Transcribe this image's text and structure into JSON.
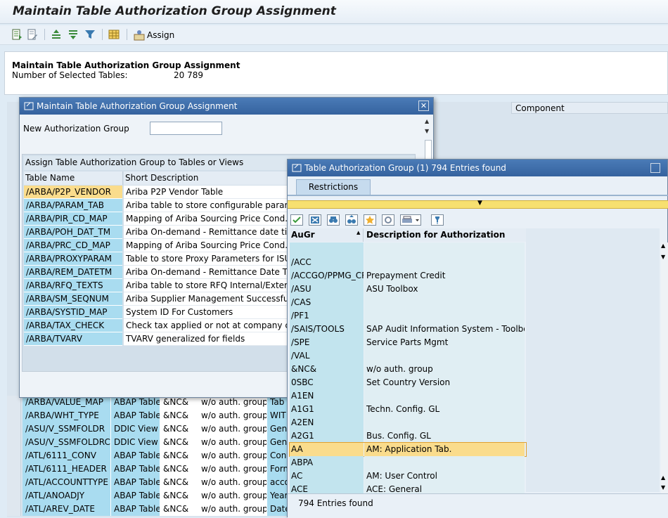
{
  "window": {
    "title": "Maintain Table Authorization Group Assignment"
  },
  "toolbar": {
    "assign_label": "Assign"
  },
  "header": {
    "title": "Maintain Table Authorization Group Assignment",
    "count_label": "Number of Selected Tables:",
    "count_value": "20 789"
  },
  "background_table": {
    "component_header": "Component",
    "rows": [
      {
        "name": "/ARBA/VALUE_MAP",
        "type": "ABAP Table",
        "aug": "&NC&",
        "desc": "w/o auth. group",
        "short": "Tab"
      },
      {
        "name": "/ARBA/WHT_TYPE",
        "type": "ABAP Table",
        "aug": "&NC&",
        "desc": "w/o auth. group",
        "short": "WIT"
      },
      {
        "name": "/ASU/V_SSMFOLDR",
        "type": "DDIC View",
        "aug": "&NC&",
        "desc": "w/o auth. group",
        "short": "Gen"
      },
      {
        "name": "/ASU/V_SSMFOLDRC",
        "type": "DDIC View",
        "aug": "&NC&",
        "desc": "w/o auth. group",
        "short": "Gen"
      },
      {
        "name": "/ATL/6111_CONV",
        "type": "ABAP Table",
        "aug": "&NC&",
        "desc": "w/o auth. group",
        "short": "Conv"
      },
      {
        "name": "/ATL/6111_HEADER",
        "type": "ABAP Table",
        "aug": "&NC&",
        "desc": "w/o auth. group",
        "short": "Form"
      },
      {
        "name": "/ATL/ACCOUNTTYPE",
        "type": "ABAP Table",
        "aug": "&NC&",
        "desc": "w/o auth. group",
        "short": "acco"
      },
      {
        "name": "/ATL/ANOADJY",
        "type": "ABAP Table",
        "aug": "&NC&",
        "desc": "w/o auth. group",
        "short": "Year"
      },
      {
        "name": "/ATL/AREV_DATE",
        "type": "ABAP Table",
        "aug": "&NC&",
        "desc": "w/o auth. group",
        "short": "Date"
      }
    ]
  },
  "dialog1": {
    "title": "Maintain Table Authorization Group Assignment",
    "new_group_label": "New Authorization Group",
    "new_group_value": "",
    "section_label": "Assign Table Authorization Group to Tables or Views",
    "col_name": "Table Name",
    "col_desc": "Short Description",
    "rows": [
      {
        "name": "/ARBA/P2P_VENDOR",
        "desc": "Ariba P2P Vendor Table"
      },
      {
        "name": "/ARBA/PARAM_TAB",
        "desc": "Ariba table to store configurable paramete"
      },
      {
        "name": "/ARBA/PIR_CD_MAP",
        "desc": "Mapping of Ariba Sourcing Price Cond. to E"
      },
      {
        "name": "/ARBA/POH_DAT_TM",
        "desc": "Ariba On-demand  - Remittance date time"
      },
      {
        "name": "/ARBA/PRC_CD_MAP",
        "desc": "Mapping of Ariba Sourcing Price Cond. to E"
      },
      {
        "name": "/ARBA/PROXYPARAM",
        "desc": "Table to store Proxy Parameters for ISU, P"
      },
      {
        "name": "/ARBA/REM_DATETM",
        "desc": "Ariba On-demand  - Remittance Date Time"
      },
      {
        "name": "/ARBA/RFQ_TEXTS",
        "desc": "Ariba table to store RFQ Internal/External"
      },
      {
        "name": "/ARBA/SM_SEQNUM",
        "desc": "Ariba Supplier Management Successful Exe"
      },
      {
        "name": "/ARBA/SYSTID_MAP",
        "desc": "System ID For Customers"
      },
      {
        "name": "/ARBA/TAX_CHECK",
        "desc": "Check tax applied or not at company code"
      },
      {
        "name": "/ARBA/TVARV",
        "desc": "TVARV generalized for fields"
      }
    ]
  },
  "dialog2": {
    "title": "Table Authorization Group (1)  794 Entries found",
    "tab_label": "Restrictions",
    "col_aug": "AuGr",
    "col_desc": "Description for Authorization Group",
    "status": "794 Entries found",
    "rows": [
      {
        "aug": "",
        "desc": ""
      },
      {
        "aug": "/ACC",
        "desc": ""
      },
      {
        "aug": "/ACCGO/PPMG_CR",
        "desc": "Prepayment Credit"
      },
      {
        "aug": "/ASU",
        "desc": "ASU Toolbox"
      },
      {
        "aug": "/CAS",
        "desc": ""
      },
      {
        "aug": "/PF1",
        "desc": ""
      },
      {
        "aug": "/SAIS/TOOLS",
        "desc": "SAP Audit Information System - Toolbox"
      },
      {
        "aug": "/SPE",
        "desc": "Service Parts Mgmt"
      },
      {
        "aug": "/VAL",
        "desc": ""
      },
      {
        "aug": "&NC&",
        "desc": "w/o auth. group"
      },
      {
        "aug": "0SBC",
        "desc": "Set Country Version"
      },
      {
        "aug": "A1EN",
        "desc": ""
      },
      {
        "aug": "A1G1",
        "desc": "Techn. Config. GL"
      },
      {
        "aug": "A2EN",
        "desc": ""
      },
      {
        "aug": "A2G1",
        "desc": "Bus. Config. GL"
      },
      {
        "aug": "AA",
        "desc": "AM: Application Tab."
      },
      {
        "aug": "ABPA",
        "desc": ""
      },
      {
        "aug": "AC",
        "desc": "AM: User Control"
      },
      {
        "aug": "ACE",
        "desc": "ACE: General"
      }
    ]
  }
}
